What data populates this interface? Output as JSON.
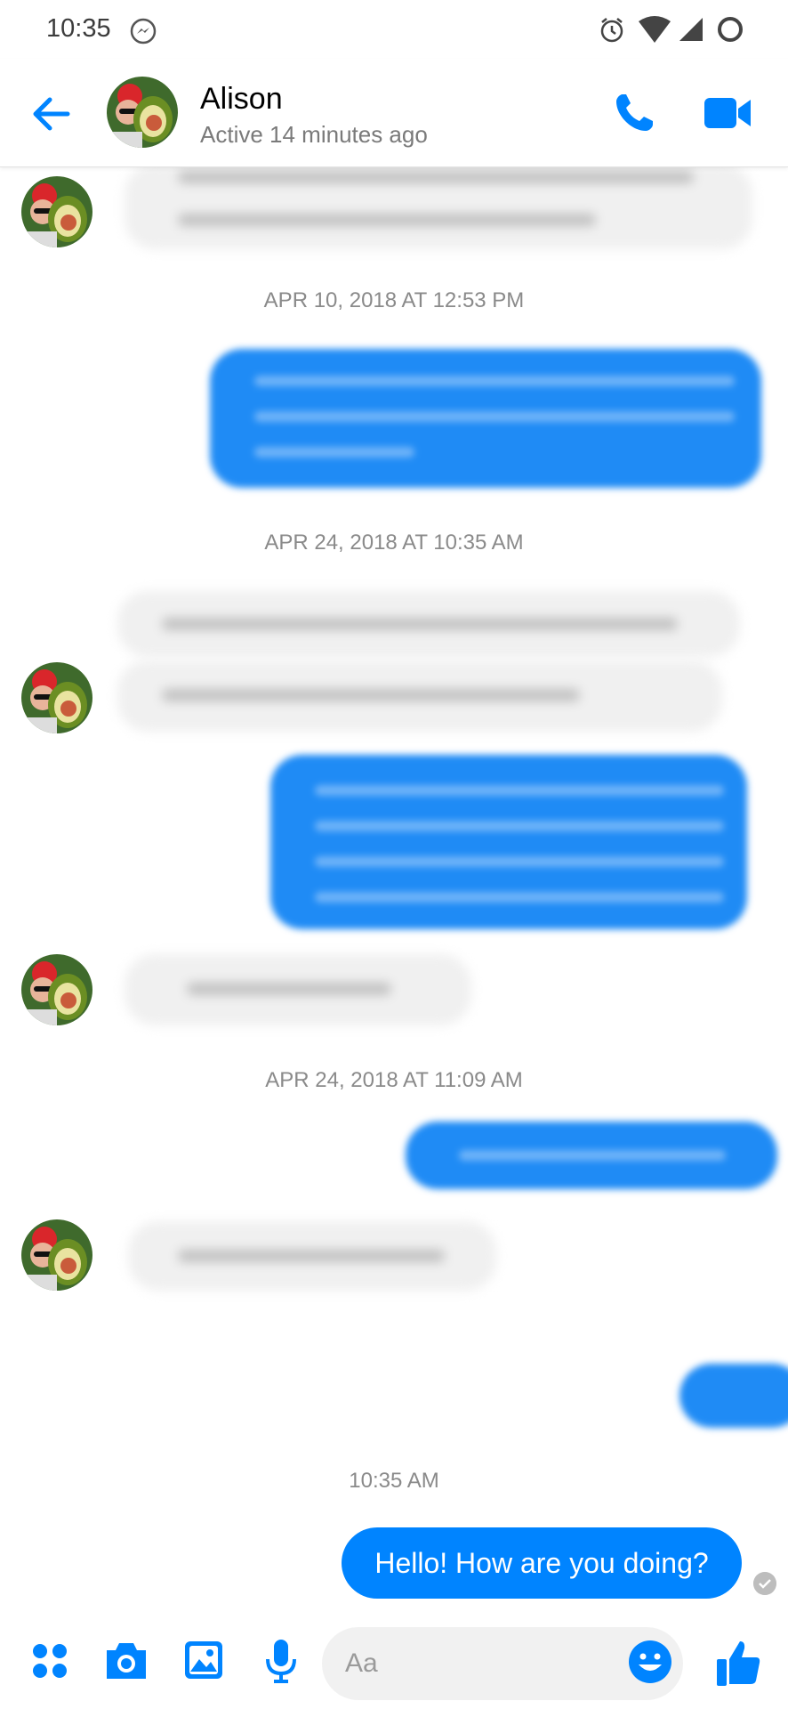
{
  "status_bar": {
    "time": "10:35",
    "icons": [
      "messenger-icon",
      "alarm-icon",
      "wifi-icon",
      "signal-icon",
      "battery-icon"
    ]
  },
  "header": {
    "contact_name": "Alison",
    "contact_status": "Active 14 minutes ago",
    "icons": [
      "back-arrow-icon",
      "phone-icon",
      "video-camera-icon"
    ]
  },
  "conversation": {
    "timestamps": [
      "APR 10, 2018 AT 12:53 PM",
      "APR 24, 2018 AT 10:35 AM",
      "APR 24, 2018 AT 11:09 AM",
      "10:35 AM"
    ],
    "last_sent_message": "Hello! How are you doing?"
  },
  "composer": {
    "input_placeholder": "Aa",
    "icons": [
      "apps-grid-icon",
      "camera-icon",
      "gallery-icon",
      "microphone-icon",
      "emoji-icon",
      "thumbs-up-icon"
    ]
  },
  "colors": {
    "accent": "#0084ff",
    "incoming_bubble": "#f0f0f0",
    "timestamp_text": "#8a8a8a"
  }
}
